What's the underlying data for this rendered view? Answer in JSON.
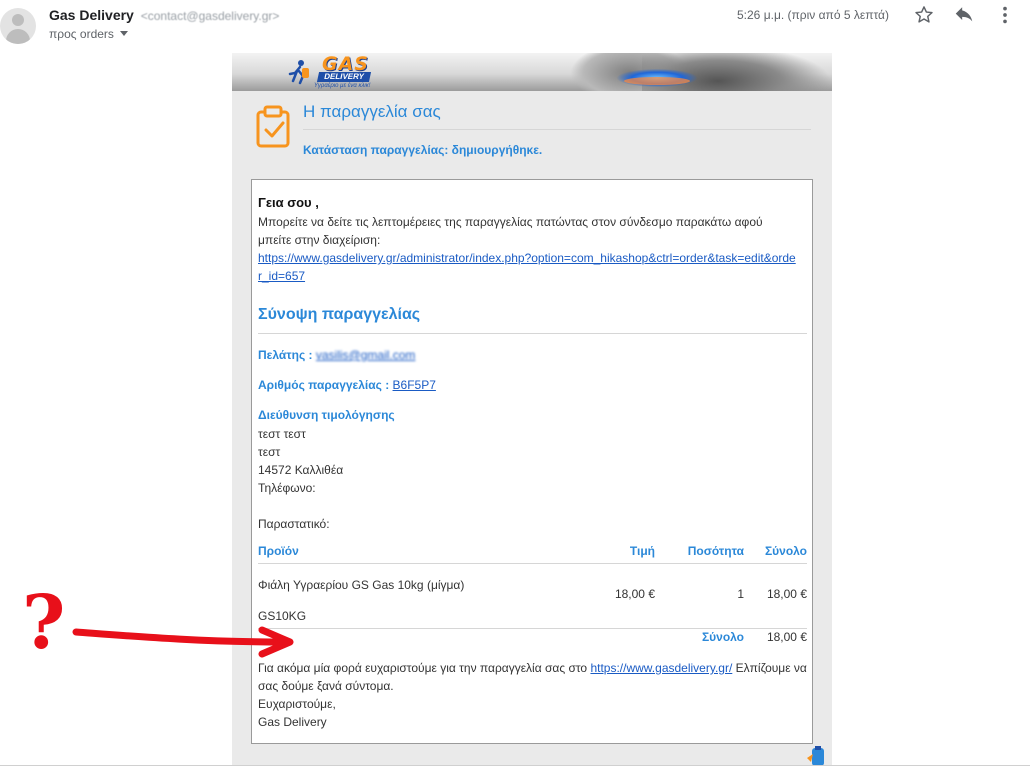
{
  "header": {
    "sender_name": "Gas Delivery",
    "sender_address": "<contact@gasdelivery.gr>",
    "recipient": "προς orders",
    "timestamp": "5:26 μ.μ. (πριν από 5 λεπτά)",
    "star_icon": "star-icon",
    "reply_icon": "reply-icon",
    "more_icon": "more-vert-icon"
  },
  "brand": {
    "logo_text": "GAS",
    "logo_subtext": "DELIVERY",
    "tagline": "Υγραέριο με ένα κλικ!",
    "primary_color": "#2b88d8",
    "accent_color": "#f7941e"
  },
  "order": {
    "title": "Η παραγγελία σας",
    "status": "Κατάσταση παραγγελίας: δημιουργήθηκε.",
    "greeting": "Γεια σου ,",
    "intro": "Μπορείτε να δείτε τις λεπτομέρειες της παραγγελίας πατώντας στον σύνδεσμο παρακάτω αφού μπείτε στην διαχείριση:",
    "admin_link": "https://www.gasdelivery.gr/administrator/index.php?option=com_hikashop&ctrl=order&task=edit&order_id=657",
    "summary_title": "Σύνοψη παραγγελίας",
    "customer_label": "Πελάτης :",
    "customer_email": "vasilis@gmail.com",
    "order_number_label": "Αριθμός παραγγελίας :",
    "order_number": "B6F5P7",
    "billing_label": "Διεύθυνση τιμολόγησης",
    "billing_lines": [
      "τεστ τεστ",
      "τεστ",
      "14572 Καλλιθέα",
      "Τηλέφωνο:"
    ],
    "invoice_label": "Παραστατικό:"
  },
  "items": {
    "columns": {
      "product": "Προϊόν",
      "price": "Τιμή",
      "quantity": "Ποσότητα",
      "total": "Σύνολο"
    },
    "rows": [
      {
        "name": "Φιάλη Υγραερίου GS Gas 10kg (μίγμα)",
        "code": "GS10KG",
        "price": "18,00 €",
        "quantity": "1",
        "total": "18,00 €"
      }
    ],
    "grand_total_label": "Σύνολο",
    "grand_total_value": "18,00 €"
  },
  "footer": {
    "thanks_prefix": "Για ακόμα μία φορά ευχαριστούμε για την παραγγελία σας στο ",
    "thanks_link": "https://www.gasdelivery.gr/",
    "thanks_suffix": " Ελπίζουμε να σας δούμε ξανά σύντομα.",
    "signoff_1": "Ευχαριστούμε,",
    "signoff_2": "Gas Delivery"
  },
  "annotation": {
    "mark": "?",
    "color": "#e8101a"
  }
}
